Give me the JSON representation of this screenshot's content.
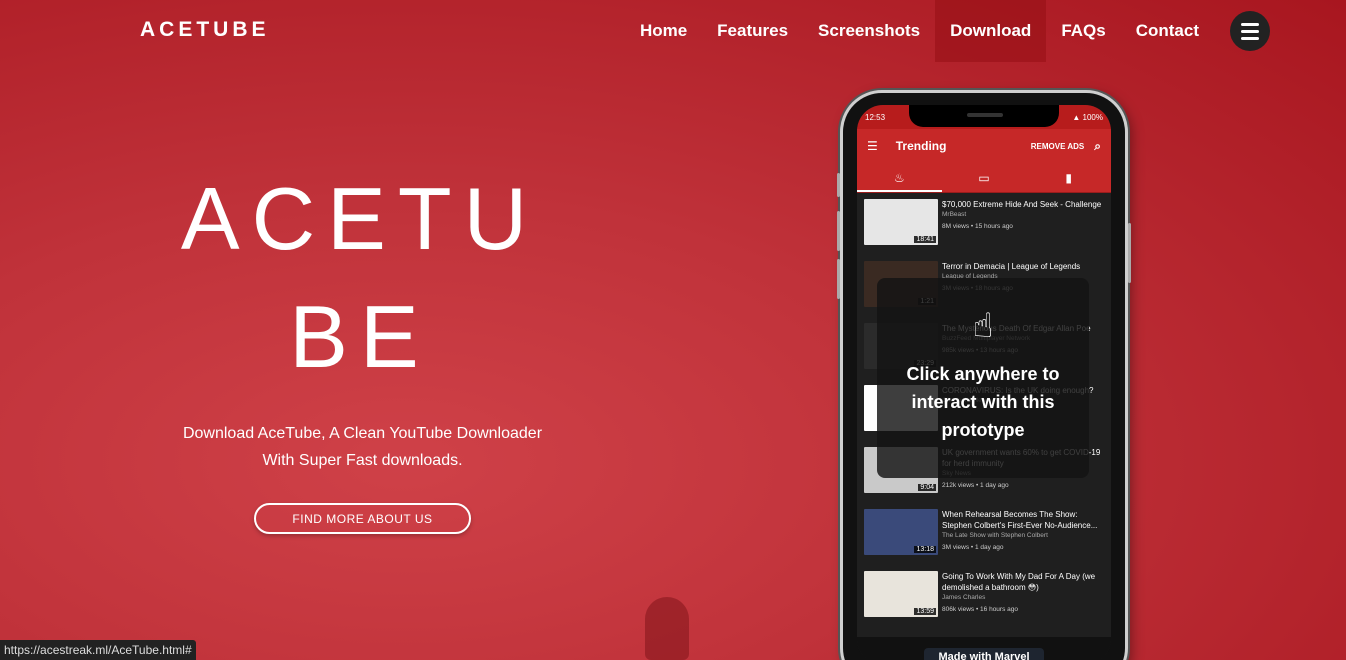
{
  "brand": "ACETUBE",
  "nav": {
    "items": [
      "Home",
      "Features",
      "Screenshots",
      "Download",
      "FAQs",
      "Contact"
    ],
    "active": "Download"
  },
  "hero": {
    "title_line1": "ACETU",
    "title_line2": "BE",
    "subtitle_line1": "Download AceTube, A Clean YouTube Downloader",
    "subtitle_line2": "With Super Fast downloads.",
    "cta": "FIND MORE ABOUT US"
  },
  "status_url": "https://acestreak.ml/AceTube.html#",
  "phone": {
    "time": "12:53",
    "battery": "100%",
    "appbar_title": "Trending",
    "remove_ads": "REMOVE ADS",
    "videos": [
      {
        "title": "$70,000 Extreme Hide And Seek - Challenge",
        "channel": "MrBeast",
        "meta": "8M views • 15 hours ago",
        "duration": "18:41",
        "color": "#e6e6e6"
      },
      {
        "title": "Terror in Demacia | League of Legends",
        "channel": "League of Legends",
        "meta": "3M views • 18 hours ago",
        "duration": "1:21",
        "color": "#3a2a22"
      },
      {
        "title": "The Mysterious Death Of Edgar Allan Poe",
        "channel": "BuzzFeed Multiplayer Network",
        "meta": "985k views • 13 hours ago",
        "duration": "23:29",
        "color": "#2b2b2b"
      },
      {
        "title": "CORONAVIRUS: Is the UK doing enough?",
        "channel": "Channel 4 News",
        "meta": "",
        "duration": "",
        "color": "#ffffff"
      },
      {
        "title": "UK government wants 60% to get COVID-19 for herd immunity",
        "channel": "Sky News",
        "meta": "212k views • 1 day ago",
        "duration": "9:04",
        "color": "#c9c9c9"
      },
      {
        "title": "When Rehearsal Becomes The Show: Stephen Colbert's First-Ever No-Audience...",
        "channel": "The Late Show with Stephen Colbert",
        "meta": "3M views • 1 day ago",
        "duration": "13:18",
        "color": "#3a4a7a"
      },
      {
        "title": "Going To Work With My Dad For A Day (we demolished a bathroom 😳)",
        "channel": "James Charles",
        "meta": "806k views • 16 hours ago",
        "duration": "13:59",
        "color": "#e8e4dc"
      }
    ]
  },
  "overlay": {
    "text": "Click anywhere to interact with this prototype"
  },
  "made_with": "Made with Marvel"
}
